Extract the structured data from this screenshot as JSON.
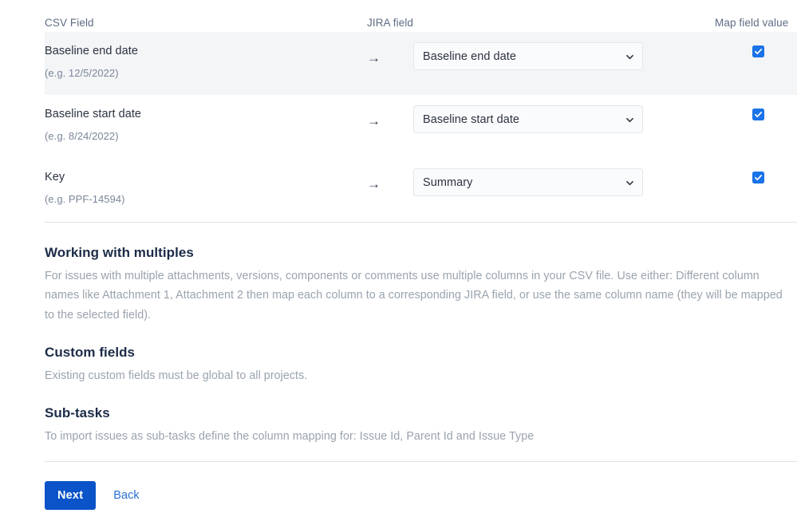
{
  "table": {
    "columns": {
      "csv_field": "CSV Field",
      "jira_field": "JIRA field",
      "map_field_value": "Map field value"
    },
    "arrow_glyph": "→",
    "rows": [
      {
        "csv_name": "Baseline end date",
        "csv_example": "(e.g. 12/5/2022)",
        "jira_value": "Baseline end date",
        "mapped": true,
        "striped": true
      },
      {
        "csv_name": "Baseline start date",
        "csv_example": "(e.g. 8/24/2022)",
        "jira_value": "Baseline start date",
        "mapped": true,
        "striped": false
      },
      {
        "csv_name": "Key",
        "csv_example": "(e.g. PPF-14594)",
        "jira_value": "Summary",
        "mapped": true,
        "striped": false
      }
    ]
  },
  "sections": [
    {
      "heading": "Working with multiples",
      "body": "For issues with multiple attachments, versions, components or comments use multiple columns in your CSV file. Use either: Different column names like Attachment 1, Attachment 2 then map each column to a corresponding JIRA field, or use the same column name (they will be mapped to the selected field)."
    },
    {
      "heading": "Custom fields",
      "body": "Existing custom fields must be global to all projects."
    },
    {
      "heading": "Sub-tasks",
      "body": "To import issues as sub-tasks define the column mapping for: Issue Id, Parent Id and Issue Type"
    }
  ],
  "footer": {
    "next_label": "Next",
    "back_label": "Back"
  },
  "colors": {
    "accent_blue": "#0a53c8",
    "link_blue": "#2a6fd4",
    "checkbox_blue": "#1a73e8",
    "stripe_gray": "#f4f5f7",
    "divider_gray": "#dfe1e6",
    "muted_text": "#9aa3ae",
    "heading_navy": "#1c2b47"
  }
}
